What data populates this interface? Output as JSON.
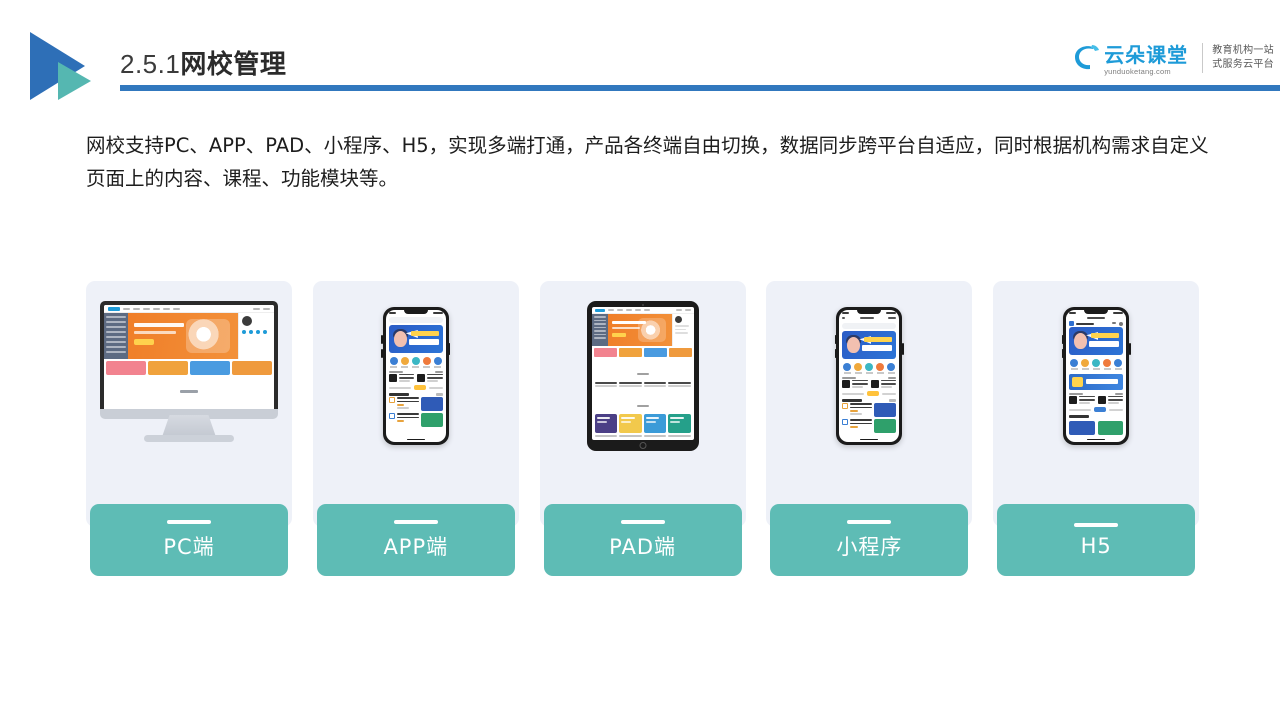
{
  "header": {
    "section_number": "2.5.1",
    "section_title": "网校管理",
    "logo_mark_name": "play-triangle-logo",
    "rule_color": "#3178BE",
    "logo_blue": "#2E6FB7",
    "logo_teal": "#55B7B1"
  },
  "brand": {
    "cloud_icon": "cloud-icon",
    "name_cn": "云朵课堂",
    "name_en": "yunduoketang.com",
    "slogan_line1": "教育机构一站",
    "slogan_line2": "式服务云平台",
    "brand_color": "#1E9BD8"
  },
  "body": {
    "paragraph": "网校支持PC、APP、PAD、小程序、H5，实现多端打通，产品各终端自由切换，数据同步跨平台自适应，同时根据机构需求自定义页面上的内容、课程、功能模块等。"
  },
  "cards": [
    {
      "label": "PC端",
      "device": "desktop-monitor",
      "accent": "#5EBCB5"
    },
    {
      "label": "APP端",
      "device": "mobile-phone",
      "accent": "#5EBCB5"
    },
    {
      "label": "PAD端",
      "device": "tablet",
      "accent": "#5EBCB5"
    },
    {
      "label": "小程序",
      "device": "mobile-phone",
      "accent": "#5EBCB5"
    },
    {
      "label": "H5",
      "device": "mobile-phone",
      "accent": "#5EBCB5"
    }
  ],
  "theme": {
    "card_background": "#eef1f8",
    "accent_teal": "#5EBCB5",
    "text_dark": "#1d1d1d",
    "page_background": "#ffffff"
  }
}
